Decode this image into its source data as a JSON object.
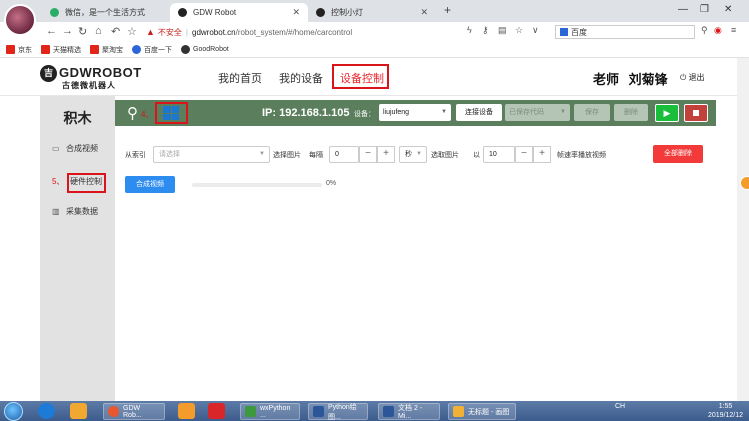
{
  "browser": {
    "tabs": [
      {
        "label": "微信，是一个生活方式",
        "active": false,
        "icon_color": "#2aae67"
      },
      {
        "label": "GDW Robot",
        "active": true,
        "icon_color": "#222222"
      },
      {
        "label": "控制小灯",
        "active": false,
        "icon_color": "#222222"
      }
    ],
    "new_tab": "+",
    "window_controls": [
      "—",
      "❐",
      "✕"
    ],
    "url_security": "不安全",
    "url_host": "gdwrobot.cn",
    "url_path": "/robot_system/#/home/carcontrol",
    "search_engine": "百度",
    "bookmarks": [
      {
        "label": "京东",
        "color": "#e1251b"
      },
      {
        "label": "天猫精选",
        "color": "#e1251b"
      },
      {
        "label": "聚淘宝",
        "color": "#e1251b"
      },
      {
        "label": "百度一下",
        "color": "#2a66d8"
      },
      {
        "label": "GoodRobot",
        "color": "#333333"
      }
    ]
  },
  "app": {
    "logo_text": "GDWROBOT",
    "logo_sub": "古德微机器人",
    "nav": [
      {
        "label": "我的首页",
        "active": false
      },
      {
        "label": "我的设备",
        "active": false
      },
      {
        "label": "设备控制",
        "active": true
      }
    ],
    "teacher_label": "老师",
    "teacher_name": "刘菊锋",
    "logout": "退出"
  },
  "sidebar": {
    "title": "积木",
    "items": [
      {
        "label": "合成视频",
        "icon": "image-icon",
        "glyph": "▭"
      },
      {
        "label": "硬件控制",
        "icon": "hardware-icon",
        "glyph": "⚙"
      },
      {
        "label": "采集数据",
        "icon": "chart-icon",
        "glyph": "▥"
      }
    ],
    "annotation_number": "5、"
  },
  "control_bar": {
    "ip_label": "IP: 192.168.1.105",
    "device_label": "设备：",
    "device_value": "liujufeng",
    "connect_button": "连接设备",
    "saved_code_placeholder": "已保存代码",
    "save_button": "保存",
    "delete_button": "删除",
    "play_glyph": "▶",
    "annotation_number": "4、",
    "colors": {
      "bar": "#5b7f5c",
      "play": "#19be3b",
      "stop": "#c2413b",
      "grid": "#1b78d1"
    }
  },
  "filters": {
    "from_index_label": "从索引",
    "from_index_placeholder": "请选择",
    "select_image_label": "选择图片",
    "every_label": "每隔",
    "every_value": "0",
    "unit_value": "秒",
    "pick_image_label": "选取图片",
    "rate_prefix": "以",
    "rate_value": "10",
    "rate_suffix": "帧速率播放视频",
    "delete_all_button": "全部删除"
  },
  "compose": {
    "button": "合成视频",
    "progress": 0,
    "progress_text": "0%"
  },
  "taskbar": {
    "apps": [
      {
        "label": "GDW Rob...",
        "color": "#e8572f"
      },
      {
        "label": "wxPython ...",
        "color": "#3c9a3c"
      },
      {
        "label": "Python绘图...",
        "color": "#2b579a"
      },
      {
        "label": "文档 2 - Mi...",
        "color": "#2b579a"
      },
      {
        "label": "无标题 - 画图",
        "color": "#f2b134"
      }
    ],
    "tray_text": "CH",
    "clock_time": "1:55",
    "clock_date": "2019/12/12"
  }
}
